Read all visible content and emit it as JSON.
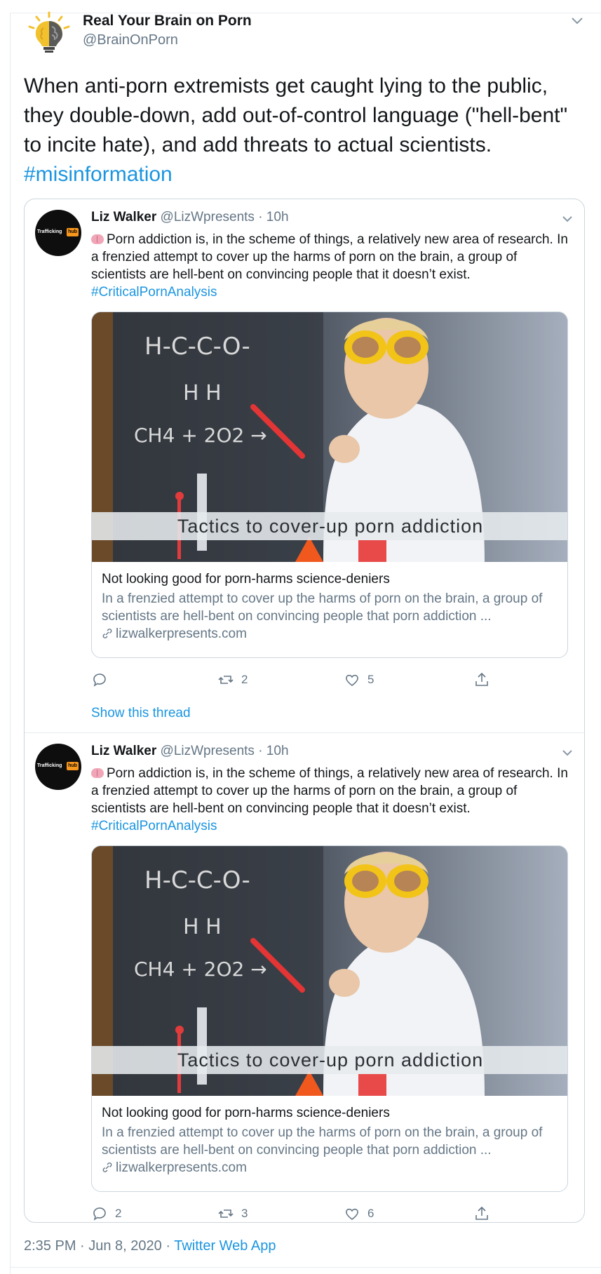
{
  "tweet": {
    "author_name": "Real Your Brain on Porn",
    "author_handle": "@BrainOnPorn",
    "text": "When anti-porn extremists get caught lying to the public, they double-down, add out-of-control language (\"hell-bent\" to incite hate), and add threats to actual scientists.",
    "hashtag": "#misinformation",
    "timestamp": "2:35 PM · Jun 8, 2020 · ",
    "source_app": "Twitter Web App",
    "avatar_icon": "brain-lightbulb-icon"
  },
  "quoted": [
    {
      "name": "Liz Walker",
      "handle_time": " @LizWpresents · 10h",
      "avatar_text": "Trafficking",
      "avatar_badge": "hub",
      "emoji_icon": "brain-emoji-icon",
      "body": "Porn addiction is, in the scheme of things, a relatively new area of research. In a frenzied attempt to cover up the harms of porn on the brain, a group of scientists are hell-bent on convincing people that it doesn’t exist.",
      "hashtag": "#CriticalPornAnalysis",
      "card": {
        "image_caption": "Tactics to cover-up porn addiction",
        "chalk_formula_1": "H-C-C-O-",
        "chalk_formula_2": "H  H",
        "chalk_formula_3": "CH4 + 2O2 →",
        "title": "Not looking good for porn-harms science-deniers",
        "description": "In a frenzied attempt to cover up the harms of porn on the brain, a group of scientists are hell-bent on convincing people that porn addiction ...",
        "domain": "lizwalkerpresents.com"
      },
      "actions": {
        "reply": "",
        "retweet": "2",
        "like": "5"
      },
      "show_thread": "Show this thread"
    },
    {
      "name": "Liz Walker",
      "handle_time": " @LizWpresents · 10h",
      "avatar_text": "Trafficking",
      "avatar_badge": "hub",
      "emoji_icon": "brain-emoji-icon",
      "body": "Porn addiction is, in the scheme of things, a relatively new area of research. In a frenzied attempt to cover up the harms of porn on the brain, a group of scientists are hell-bent on convincing people that it doesn’t exist.",
      "hashtag": "#CriticalPornAnalysis",
      "card": {
        "image_caption": "Tactics to cover-up porn addiction",
        "chalk_formula_1": "H-C-C-O-",
        "chalk_formula_2": "H  H",
        "chalk_formula_3": "CH4 + 2O2 →",
        "title": "Not looking good for porn-harms science-deniers",
        "description": "In a frenzied attempt to cover up the harms of porn on the brain, a group of scientists are hell-bent on convincing people that porn addiction ...",
        "domain": "lizwalkerpresents.com"
      },
      "actions": {
        "reply": "2",
        "retweet": "3",
        "like": "6"
      }
    }
  ],
  "colors": {
    "link": "#1b95e0",
    "secondary_text": "#657786",
    "border": "#ccd6dd",
    "badge_orange": "#f7971d"
  }
}
